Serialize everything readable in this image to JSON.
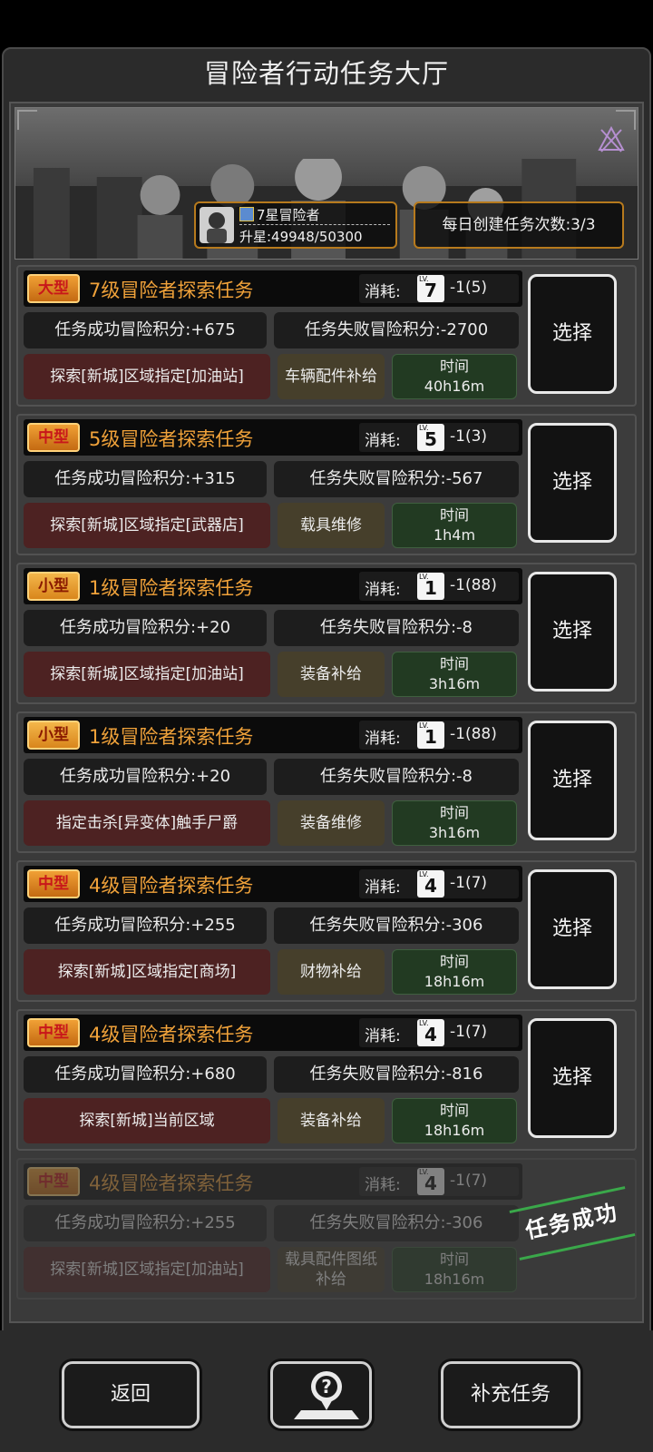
{
  "page_title": "冒险者行动任务大厅",
  "rank": {
    "title": "7星冒险者",
    "progress_text": "升星:49948/50300"
  },
  "daily": {
    "text": "每日创建任务次数:3/3"
  },
  "cost_label": "消耗:",
  "select_label": "选择",
  "time_label": "时间",
  "missions": [
    {
      "tag": "大型",
      "name": "7级冒险者探索任务",
      "level": "7",
      "cost": "-1(5)",
      "success": "任务成功冒险积分:+675",
      "fail": "任务失败冒险积分:-2700",
      "target": "探索[新城]区域指定[加油站]",
      "reward": "车辆配件补给",
      "time": "40h16m"
    },
    {
      "tag": "中型",
      "name": "5级冒险者探索任务",
      "level": "5",
      "cost": "-1(3)",
      "success": "任务成功冒险积分:+315",
      "fail": "任务失败冒险积分:-567",
      "target": "探索[新城]区域指定[武器店]",
      "reward": "载具维修",
      "time": "1h4m"
    },
    {
      "tag": "小型",
      "name": "1级冒险者探索任务",
      "level": "1",
      "cost": "-1(88)",
      "success": "任务成功冒险积分:+20",
      "fail": "任务失败冒险积分:-8",
      "target": "探索[新城]区域指定[加油站]",
      "reward": "装备补给",
      "time": "3h16m"
    },
    {
      "tag": "小型",
      "name": "1级冒险者探索任务",
      "level": "1",
      "cost": "-1(88)",
      "success": "任务成功冒险积分:+20",
      "fail": "任务失败冒险积分:-8",
      "target": "指定击杀[异变体]触手尸爵",
      "reward": "装备维修",
      "time": "3h16m"
    },
    {
      "tag": "中型",
      "name": "4级冒险者探索任务",
      "level": "4",
      "cost": "-1(7)",
      "success": "任务成功冒险积分:+255",
      "fail": "任务失败冒险积分:-306",
      "target": "探索[新城]区域指定[商场]",
      "reward": "财物补给",
      "time": "18h16m"
    },
    {
      "tag": "中型",
      "name": "4级冒险者探索任务",
      "level": "4",
      "cost": "-1(7)",
      "success": "任务成功冒险积分:+680",
      "fail": "任务失败冒险积分:-816",
      "target": "探索[新城]当前区域",
      "reward": "装备补给",
      "time": "18h16m"
    },
    {
      "tag": "中型",
      "name": "4级冒险者探索任务",
      "level": "4",
      "cost": "-1(7)",
      "success": "任务成功冒险积分:+255",
      "fail": "任务失败冒险积分:-306",
      "target": "探索[新城]区域指定[加油站]",
      "reward": "载具配件图纸补给",
      "time": "18h16m"
    }
  ],
  "completed_stamp": "任务成功",
  "buttons": {
    "back": "返回",
    "refill": "补充任务"
  },
  "icons": {
    "help": "question-map-icon",
    "rank_badge": "crown-icon"
  }
}
